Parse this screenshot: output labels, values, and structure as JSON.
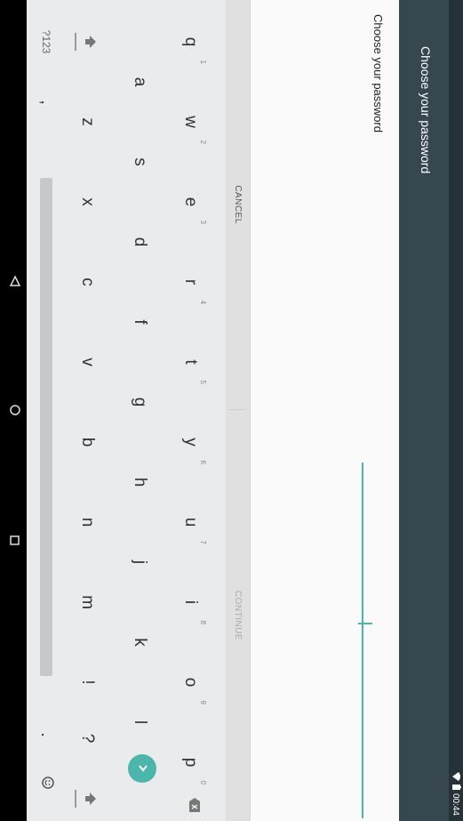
{
  "status": {
    "time": "00:44"
  },
  "app_bar": {
    "title": "Choose your password"
  },
  "content": {
    "header": "Choose your password"
  },
  "buttons": {
    "cancel": "CANCEL",
    "continue": "CONTINUE"
  },
  "keyboard": {
    "rows": [
      [
        {
          "char": "q",
          "hint": "1"
        },
        {
          "char": "w",
          "hint": "2"
        },
        {
          "char": "e",
          "hint": "3"
        },
        {
          "char": "r",
          "hint": "4"
        },
        {
          "char": "t",
          "hint": "5"
        },
        {
          "char": "y",
          "hint": "6"
        },
        {
          "char": "u",
          "hint": "7"
        },
        {
          "char": "i",
          "hint": "8"
        },
        {
          "char": "o",
          "hint": "9"
        },
        {
          "char": "p",
          "hint": "0"
        }
      ],
      [
        "a",
        "s",
        "d",
        "f",
        "g",
        "h",
        "j",
        "k",
        "l"
      ],
      [
        "z",
        "x",
        "c",
        "v",
        "b",
        "n",
        "m",
        "!",
        "?"
      ]
    ],
    "symbols_key": "?123",
    "comma": ",",
    "period": "."
  },
  "colors": {
    "accent": "#4db6ac",
    "app_bar": "#37474f",
    "status_bar": "#263238"
  }
}
